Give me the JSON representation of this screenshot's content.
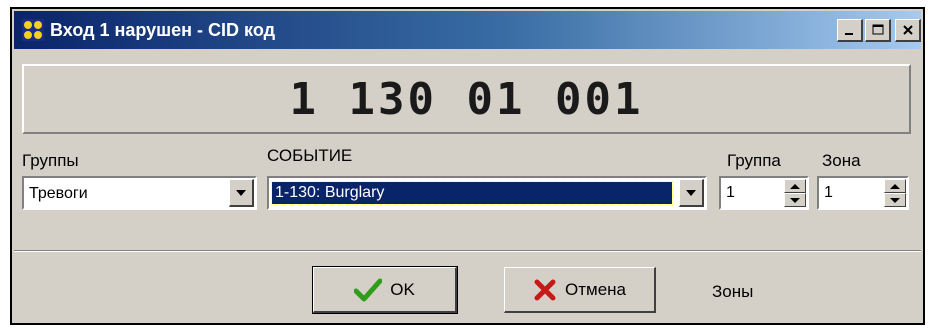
{
  "window": {
    "title": "Вход 1 нарушен - CID код",
    "icon": "app-icon",
    "controls": [
      "minimize-icon",
      "maximize-icon",
      "close-icon"
    ]
  },
  "cid_code": "1 130 01 001",
  "fields": {
    "groups": {
      "label": "Группы",
      "value": "Тревоги"
    },
    "event": {
      "label": "СОБЫТИЕ",
      "value": "1-130: Burglary"
    },
    "group": {
      "label": "Группа",
      "value": "1"
    },
    "zone": {
      "label": "Зона",
      "value": "1"
    }
  },
  "buttons": {
    "ok": {
      "label": "OK",
      "icon": "check-icon",
      "icon_color": "#2e9e1a"
    },
    "cancel": {
      "label": "Отмена",
      "icon": "cross-icon",
      "icon_color": "#c81818"
    }
  },
  "zones_label": "Зоны",
  "colors": {
    "title_bar": "#0a246a",
    "selection": "#0a246a",
    "face": "#d4d0c8"
  }
}
